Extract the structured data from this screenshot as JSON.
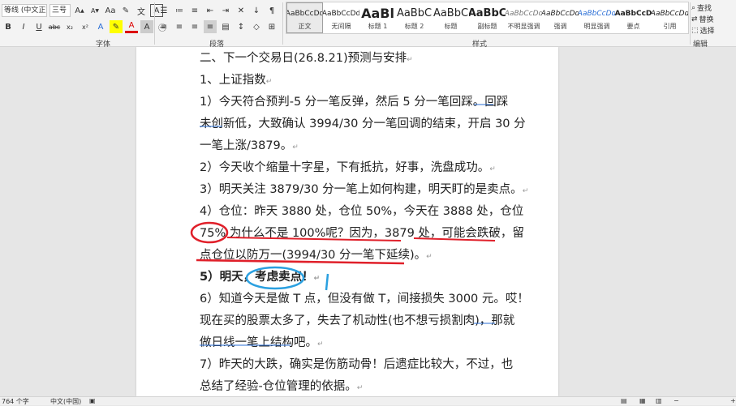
{
  "ribbon": {
    "font_name": "等线 (中文正文)",
    "font_size": "三号",
    "font_group_label": "字体",
    "paragraph_group_label": "段落",
    "styles_group_label": "样式",
    "editing_group_label": "编辑",
    "styles": [
      {
        "preview": "AaBbCcDd",
        "name": "正文"
      },
      {
        "preview": "AaBbCcDd",
        "name": "无间隔"
      },
      {
        "preview": "AaBl",
        "name": "标题 1"
      },
      {
        "preview": "AaBbC",
        "name": "标题 2"
      },
      {
        "preview": "AaBbC",
        "name": "标题"
      },
      {
        "preview": "AaBbC",
        "name": "副标题"
      },
      {
        "preview": "AaBbCcDd",
        "name": "不明显强调"
      },
      {
        "preview": "AaBbCcDd",
        "name": "强调"
      },
      {
        "preview": "AaBbCcDd",
        "name": "明显强调"
      },
      {
        "preview": "AaBbCcD",
        "name": "要点"
      },
      {
        "preview": "AaBbCcDd",
        "name": "引用"
      }
    ],
    "find_label": "查找",
    "replace_label": "替换",
    "select_label": "选择"
  },
  "document": {
    "lines": [
      {
        "text": "二、下一个交易日(26.8.21)预测与安排"
      },
      {
        "text": "1、上证指数"
      },
      {
        "text": "1）今天符合预判-5 分一笔反弹，然后 5 分一笔回踩。回踩"
      },
      {
        "text": "未创新低，大致确认 3994/30 分一笔回调的结束，开启 30 分"
      },
      {
        "text": "一笔上涨/3879。"
      },
      {
        "text": "2）今天收个缩量十字星，下有抵抗，好事，洗盘成功。"
      },
      {
        "text": "3）明天关注 3879/30 分一笔上如何构建，明天盯的是卖点。"
      },
      {
        "text": "4）仓位：昨天 3880 处，仓位 50%，今天在 3888 处，仓位"
      },
      {
        "text": "75% 为什么不是 100%呢？因为，3879 处，可能会跌破，留"
      },
      {
        "text": "点仓位以防万一(3994/30 分一笔下延续)。"
      },
      {
        "text": "5）明天，考虑卖点！"
      },
      {
        "text": "6）知道今天是做 T 点，但没有做 T，间接损失 3000 元。哎！"
      },
      {
        "text": "现在买的股票太多了，失去了机动性(也不想亏损割肉)，那就"
      },
      {
        "text": "做日线一笔上结构吧。"
      },
      {
        "text": "7）昨天的大跌，确实是伤筋动骨！后遗症比较大，不过，也"
      },
      {
        "text": "总结了经验-仓位管理的依据。"
      }
    ],
    "paragraph_mark": "↵"
  },
  "status_bar": {
    "word_count": "764 个字",
    "language": "中文(中国)"
  },
  "colors": {
    "annotation_red": "#e0202a",
    "annotation_blue": "#2aa0e0"
  }
}
